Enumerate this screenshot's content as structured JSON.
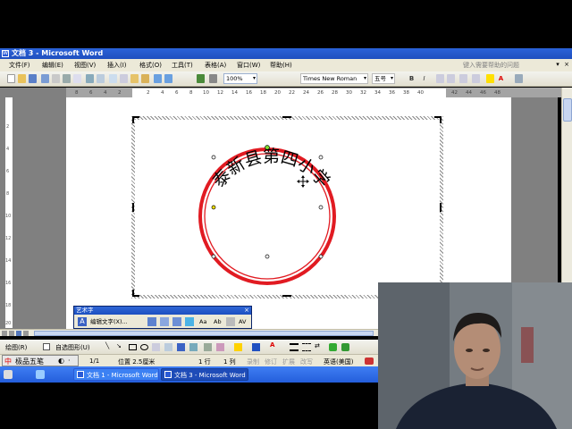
{
  "window": {
    "title": "文档 3 - Microsoft Word",
    "icon_glyph": "W"
  },
  "menu": {
    "items": [
      "文件(F)",
      "编辑(E)",
      "视图(V)",
      "插入(I)",
      "格式(O)",
      "工具(T)",
      "表格(A)",
      "窗口(W)",
      "帮助(H)"
    ],
    "help_placeholder": "键入需要帮助的问题",
    "controls": [
      "▾",
      "×"
    ]
  },
  "toolbar": {
    "zoom": "100%",
    "font": "Times New Roman",
    "size": "五号",
    "bold_label": "B",
    "italic_label": "I"
  },
  "ruler": {
    "h_ticks": [
      "8",
      "6",
      "4",
      "2",
      "2",
      "4",
      "6",
      "8",
      "10",
      "12",
      "14",
      "16",
      "18",
      "20",
      "22",
      "24",
      "26",
      "28",
      "30",
      "32",
      "34",
      "36",
      "38",
      "40",
      "42",
      "44",
      "46",
      "48"
    ],
    "v_ticks": [
      "2",
      "4",
      "6",
      "8",
      "10",
      "12",
      "14",
      "16",
      "18",
      "20"
    ]
  },
  "wordart": {
    "text": "泰新县第四小学",
    "ring_color": "#e11b22"
  },
  "wordart_toolbar": {
    "title": "艺术字",
    "edit_label": "编辑文字(X)...",
    "close": "×",
    "buttons": [
      "Aa",
      "Ab",
      "AV"
    ]
  },
  "drawing_toolbar": {
    "draw_label": "绘图(R)",
    "autoshape_label": "自选图形(U)"
  },
  "status": {
    "ime_label": "极品五笔",
    "page": "1/1",
    "position": "位置 2.5厘米",
    "line": "1 行",
    "column": "1 列",
    "modes": [
      "录制",
      "修订",
      "扩展",
      "改写"
    ],
    "language": "英语(美国)"
  },
  "taskbar": {
    "buttons": [
      "文档 1 - Microsoft Word",
      "文档 3 - Microsoft Word"
    ]
  }
}
